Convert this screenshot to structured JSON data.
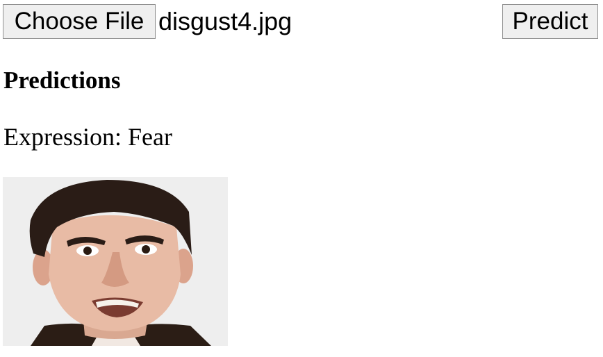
{
  "upload": {
    "choose_file_label": "Choose File",
    "selected_file": "disgust4.jpg",
    "predict_label": "Predict"
  },
  "results": {
    "heading": "Predictions",
    "expression_label": "Expression:",
    "expression_value": "Fear"
  },
  "image": {
    "subject": "face-photo",
    "background_color": "#eeeeee"
  }
}
